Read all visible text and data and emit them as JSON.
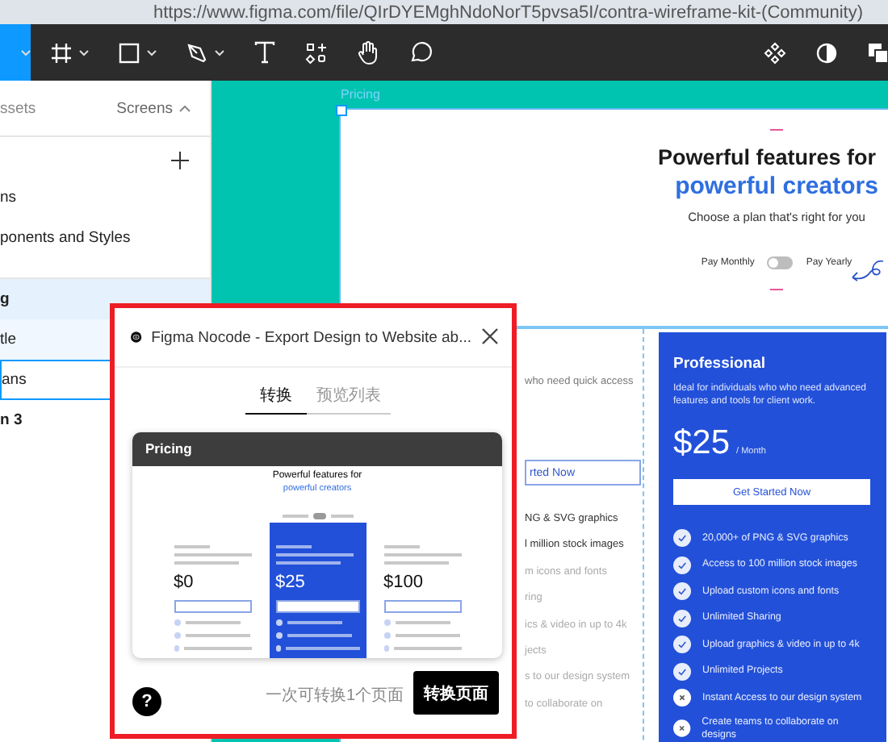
{
  "browser": {
    "url": "https://www.figma.com/file/QIrDYEMghNdoNorT5pvsa5I/contra-wireframe-kit-(Community)"
  },
  "toolbar": {
    "tools": [
      {
        "kind": "move",
        "selected": true,
        "menu": true
      },
      {
        "kind": "frame",
        "selected": false,
        "menu": true
      },
      {
        "kind": "rectangle",
        "selected": false,
        "menu": true
      },
      {
        "kind": "pen",
        "selected": false,
        "menu": true
      },
      {
        "kind": "text",
        "selected": false,
        "menu": false
      },
      {
        "kind": "resources",
        "selected": false,
        "menu": false
      },
      {
        "kind": "hand",
        "selected": false,
        "menu": false
      },
      {
        "kind": "comment",
        "selected": false,
        "menu": false
      }
    ],
    "right_tools": [
      {
        "kind": "component"
      },
      {
        "kind": "contrast"
      },
      {
        "kind": "squares"
      }
    ]
  },
  "left_panel": {
    "tabs": [
      {
        "label": "ssets",
        "selected": false
      },
      {
        "label": "Screens",
        "selected": true
      }
    ],
    "pages": [
      {
        "label": "ns"
      },
      {
        "label": "ponents and Styles"
      }
    ],
    "layers": [
      {
        "label": "g",
        "selected": true,
        "in_selection": false,
        "hovered": false
      },
      {
        "label": "tle",
        "selected": false,
        "in_selection": true,
        "hovered": false
      },
      {
        "label": "ans",
        "selected": false,
        "in_selection": false,
        "hovered": true
      },
      {
        "label": "n 3",
        "selected": false,
        "in_selection": false,
        "hovered": false
      }
    ]
  },
  "canvas": {
    "frame_label": "Pricing",
    "header": {
      "title": "Powerful features for",
      "highlight": "powerful creators",
      "subtitle": "Choose a plan that's right for you",
      "toggle": {
        "left": "Pay Monthly",
        "right": "Pay Yearly",
        "on": false
      }
    },
    "free_plan": {
      "description": "who need quick access",
      "button": "rted Now",
      "features": [
        {
          "text": "NG & SVG graphics",
          "included": true
        },
        {
          "text": "l million stock images",
          "included": true
        },
        {
          "text": "m icons and fonts",
          "included": false
        },
        {
          "text": "ring",
          "included": false
        },
        {
          "text": "ics & video in up to 4k",
          "included": false
        },
        {
          "text": "jects",
          "included": false
        },
        {
          "text": "s to our design system",
          "included": false
        },
        {
          "text": "to collaborate on",
          "included": false
        }
      ]
    },
    "pro_plan": {
      "name": "Professional",
      "description": "Ideal for individuals who who need advanced features and tools for client work.",
      "price": "$25",
      "period": "/ Month",
      "button": "Get Started Now",
      "features": [
        {
          "text": "20,000+ of PNG & SVG graphics",
          "included": true
        },
        {
          "text": "Access to 100 million stock images",
          "included": true
        },
        {
          "text": "Upload custom icons and fonts",
          "included": true
        },
        {
          "text": "Unlimited Sharing",
          "included": true
        },
        {
          "text": "Upload graphics & video in up to 4k",
          "included": true
        },
        {
          "text": "Unlimited Projects",
          "included": true
        },
        {
          "text": "Instant Access to our design system",
          "included": false
        },
        {
          "text": "Create teams to collaborate on designs",
          "included": false
        }
      ]
    }
  },
  "dialog": {
    "title": "Figma Nocode - Export Design to Website ab...",
    "tabs": [
      {
        "label": "转换",
        "selected": true
      },
      {
        "label": "预览列表",
        "selected": false
      }
    ],
    "preview": {
      "header": "Pricing",
      "title": "Powerful features for",
      "highlight": "powerful creators",
      "plans": [
        {
          "price": "$0",
          "featured": false
        },
        {
          "price": "$25",
          "featured": true
        },
        {
          "price": "$100",
          "featured": false
        }
      ]
    },
    "note": "一次可转换1个页面",
    "button": "转换页面",
    "help": "?"
  }
}
